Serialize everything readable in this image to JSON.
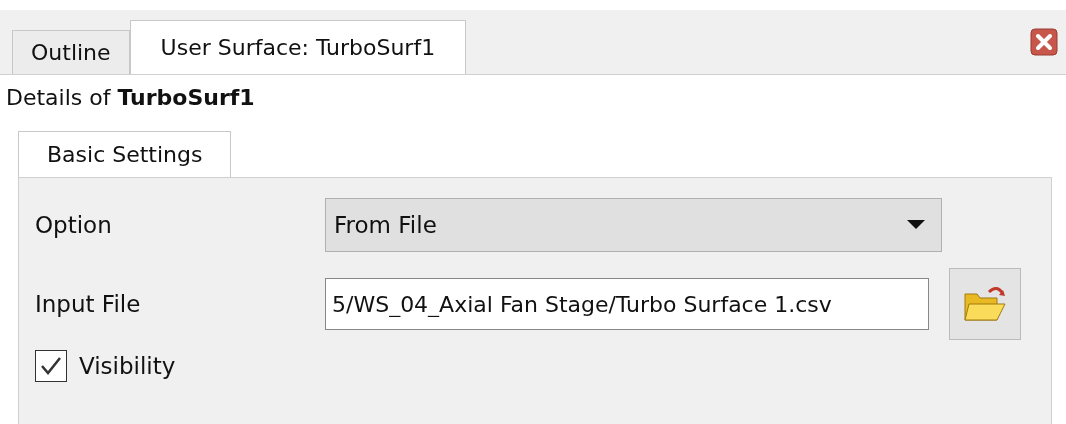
{
  "tabs": [
    {
      "label": "Outline",
      "selected": false
    },
    {
      "label": "User Surface: TurboSurf1",
      "selected": true
    }
  ],
  "details": {
    "prefix": "Details of ",
    "name": "TurboSurf1"
  },
  "inner_tabs": [
    {
      "label": "Basic Settings",
      "selected": true
    }
  ],
  "fields": [
    {
      "kind": "dropdown",
      "label": "Option",
      "value": "From File"
    },
    {
      "kind": "file",
      "label": "Input File",
      "value": "5/WS_04_Axial Fan Stage/Turbo Surface 1.csv"
    },
    {
      "kind": "checkbox",
      "label": "Visibility",
      "checked": true
    }
  ]
}
